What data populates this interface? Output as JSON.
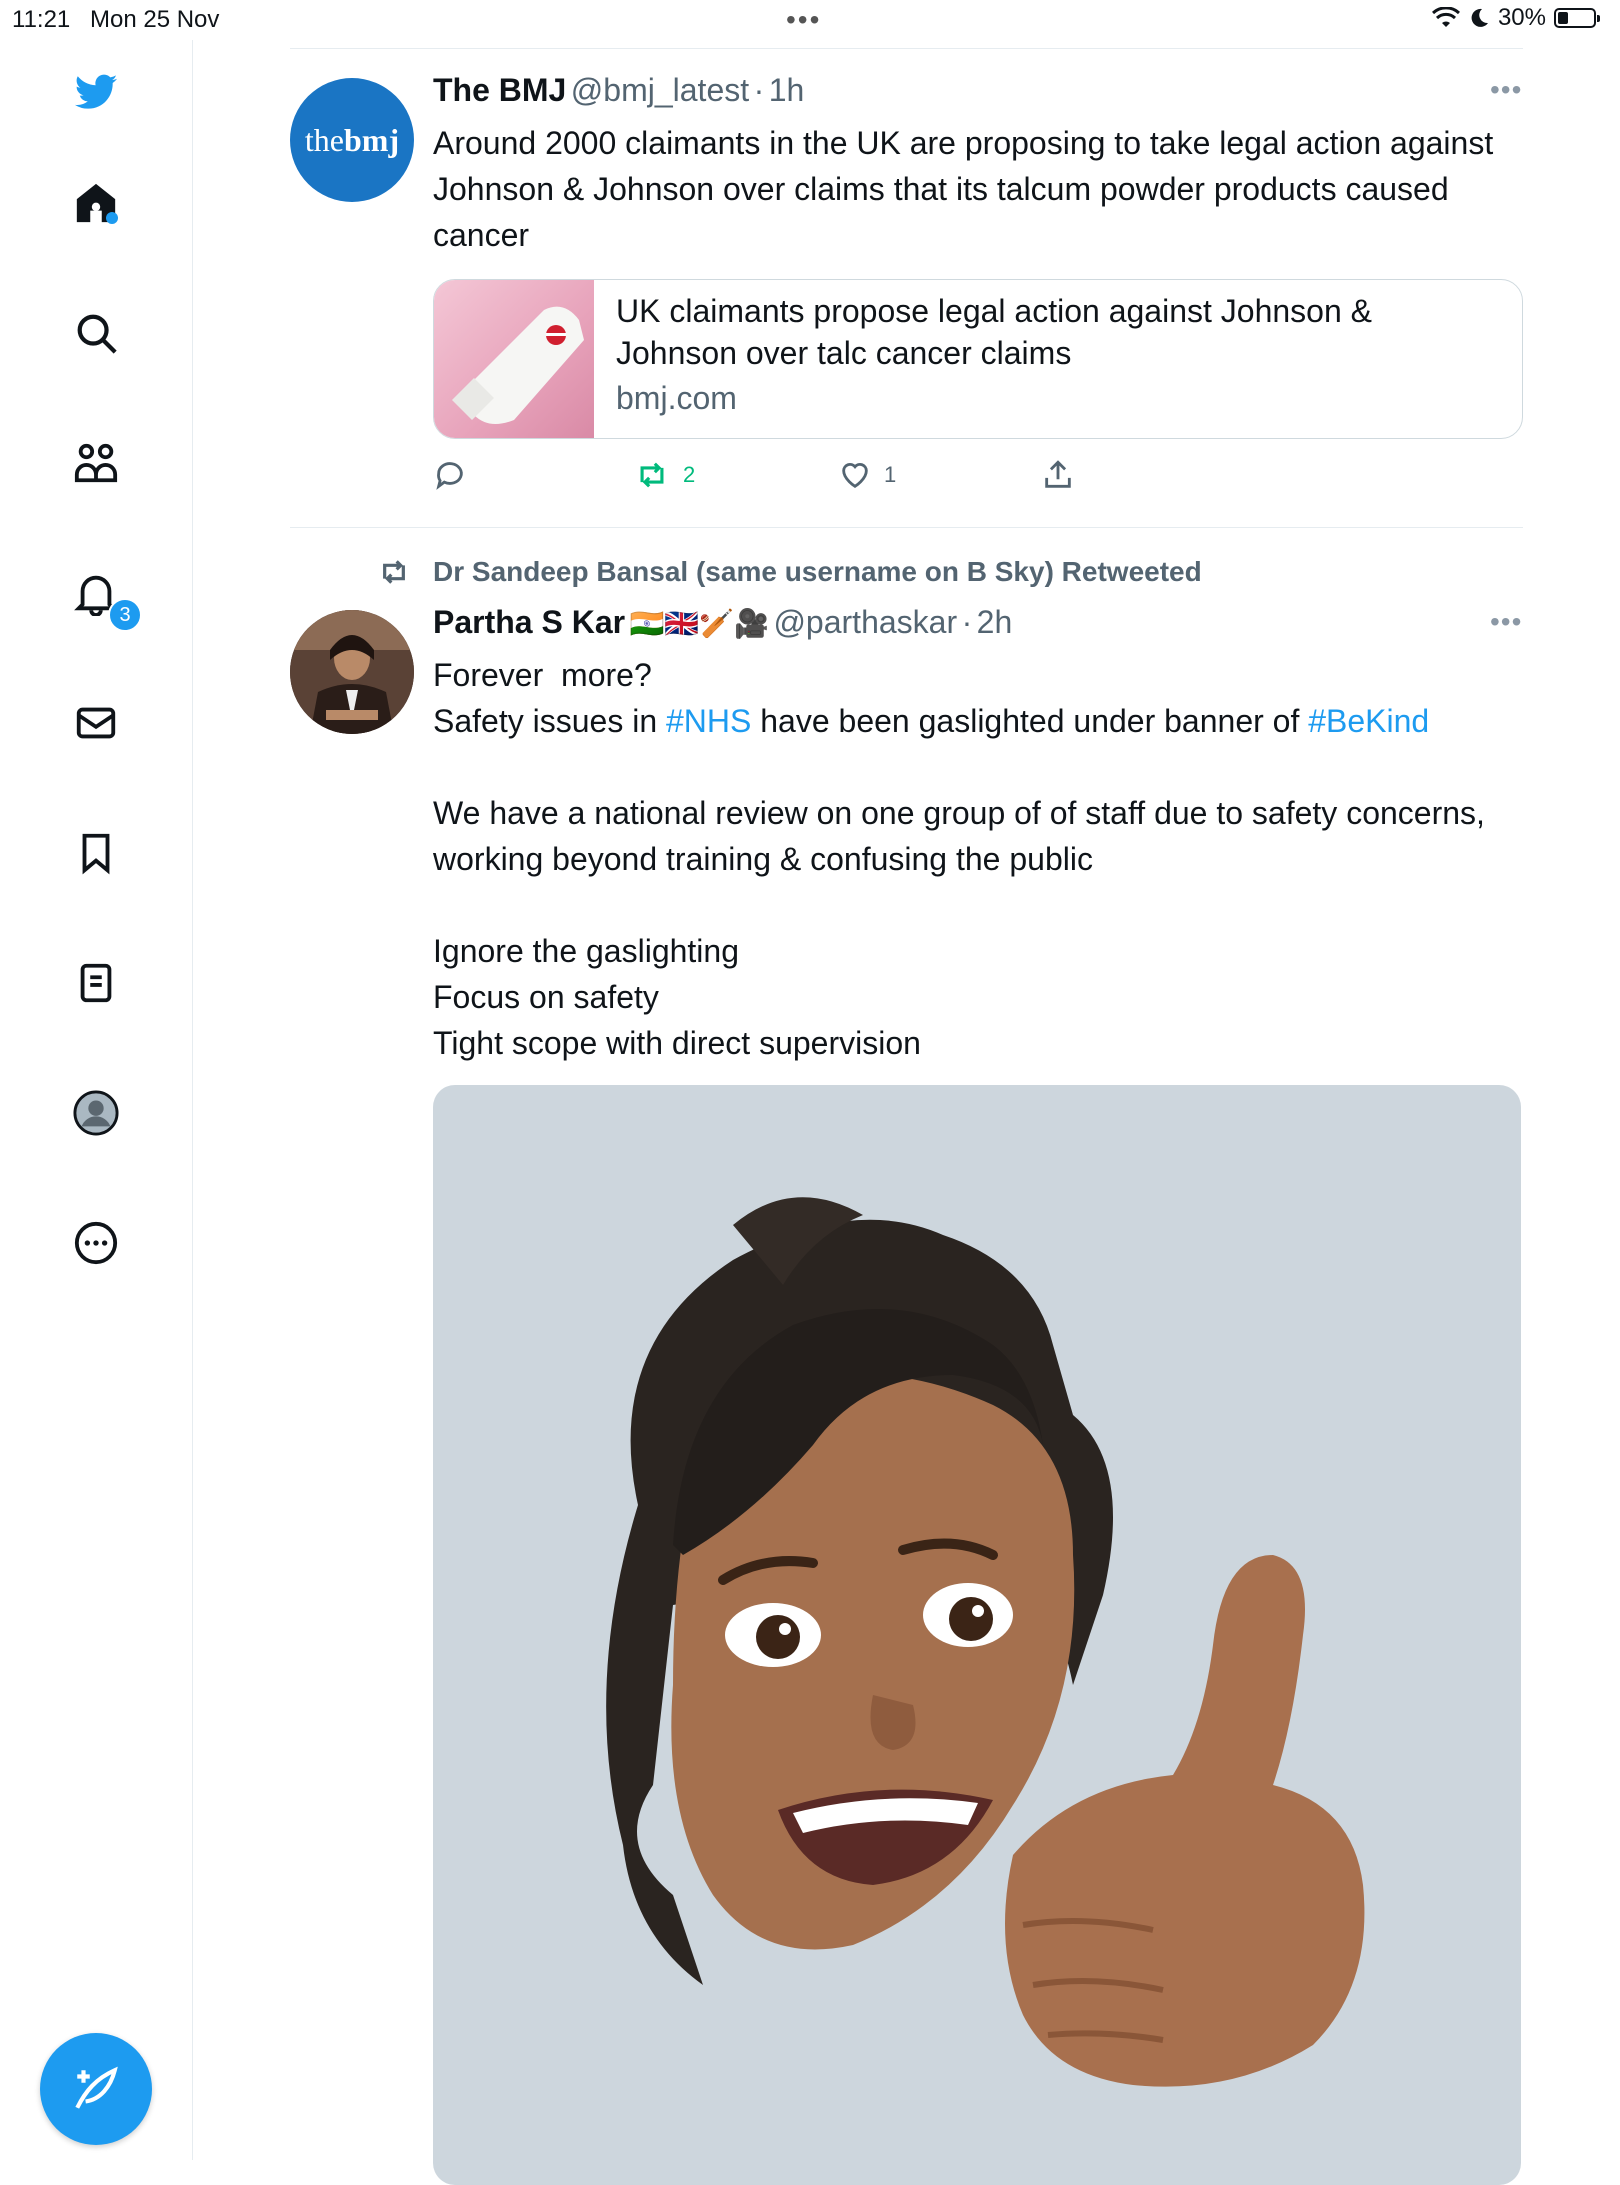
{
  "status": {
    "time": "11:21",
    "date": "Mon 25 Nov",
    "battery": "30%"
  },
  "sidebar": {
    "notifications_count": "3"
  },
  "tweet1": {
    "name": "The BMJ",
    "handle": "@bmj_latest",
    "sep": "·",
    "time": "1h",
    "avatar_text": "the",
    "avatar_text_bold": "bmj",
    "text": "Around 2000 claimants in the UK are proposing to take legal action against Johnson & Johnson over claims that its talcum powder products caused cancer",
    "card_title": "UK claimants propose legal action against Johnson & Johnson over talc cancer claims",
    "card_domain": "bmj.com",
    "retweets": "2",
    "likes": "1"
  },
  "tweet2": {
    "retweeted_by": "Dr Sandeep Bansal (same username on B Sky) Retweeted",
    "name": "Partha S Kar",
    "emojis": "🇮🇳🇬🇧🏏🎥",
    "handle": "@parthaskar",
    "sep": "·",
    "time": "2h",
    "line1": "Forever  more?",
    "line2_pre": "Safety issues in ",
    "hashtag1": "#NHS",
    "line2_mid": " have been gaslighted under banner of ",
    "hashtag2": "#BeKind",
    "para2": "We have a national review on one group of of staff due to safety concerns, working beyond training & confusing the public",
    "para3": "Ignore the gaslighting\nFocus on safety\nTight scope with direct supervision"
  },
  "colors": {
    "accent": "#1d9bf0",
    "retweet": "#00ba7c"
  }
}
